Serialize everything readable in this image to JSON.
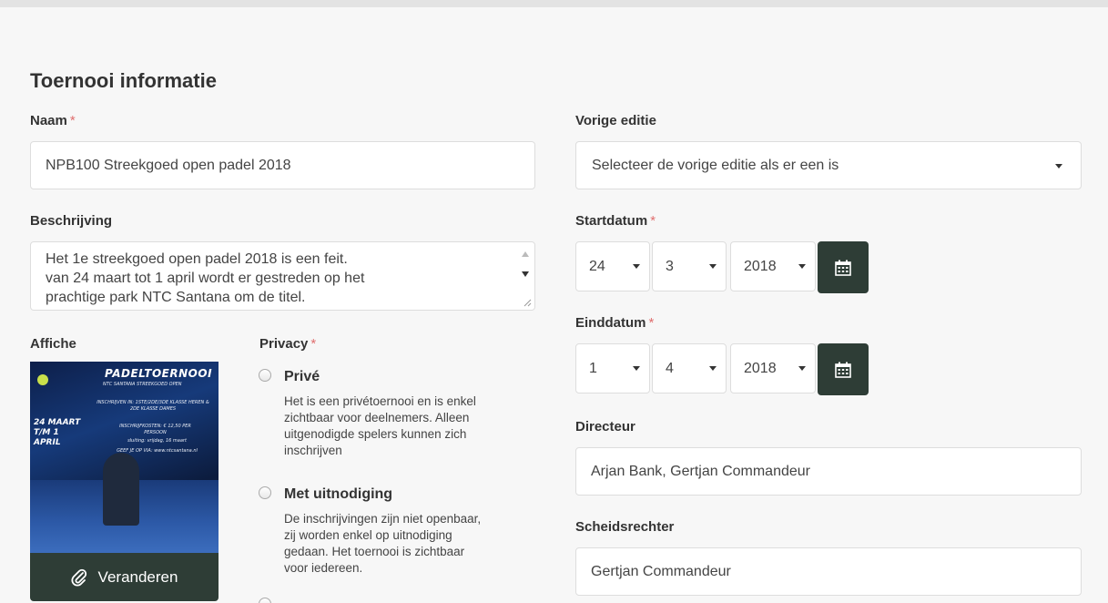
{
  "section_title": "Toernooi informatie",
  "required_mark": "*",
  "naam": {
    "label": "Naam",
    "value": "NPB100 Streekgoed open padel 2018"
  },
  "vorige_editie": {
    "label": "Vorige editie",
    "selected": "Selecteer de vorige editie als er een is"
  },
  "beschrijving": {
    "label": "Beschrijving",
    "line1": "Het 1e streekgoed open padel 2018 is een feit.",
    "line2": "van 24 maart tot 1 april wordt er gestreden op het",
    "line3": "prachtige park NTC Santana om de titel."
  },
  "startdatum": {
    "label": "Startdatum",
    "day": "24",
    "month": "3",
    "year": "2018"
  },
  "einddatum": {
    "label": "Einddatum",
    "day": "1",
    "month": "4",
    "year": "2018"
  },
  "affiche": {
    "label": "Affiche",
    "change_button": "Veranderen",
    "poster_title": "PADELTOERNOOI",
    "poster_subtitle": "NTC SANTANA STREEKGOED OPEN",
    "poster_dates": "24 MAART T/M 1 APRIL",
    "poster_info1": "INSCHRIJVEN IN: 1STE/2DE/3DE KLASSE HEREN & 2DE KLASSE DAMES",
    "poster_info2": "INSCHRIJFKOSTEN: € 12,50 PER PERSOON",
    "poster_info3": "sluiting: vrijdag, 16 maart",
    "poster_info4": "GEEF JE OP VIA: www.ntcsantana.nl"
  },
  "privacy": {
    "label": "Privacy",
    "options": [
      {
        "title": "Privé",
        "desc": [
          "Het is een privétoernooi en is enkel",
          "zichtbaar voor deelnemers. Alleen",
          "uitgenodigde spelers kunnen zich",
          "inschrijven"
        ]
      },
      {
        "title": "Met uitnodiging",
        "desc": [
          "De inschrijvingen zijn niet openbaar,",
          "zij worden enkel op uitnodiging",
          "gedaan. Het toernooi is zichtbaar",
          "voor iedereen."
        ]
      }
    ]
  },
  "directeur": {
    "label": "Directeur",
    "value": "Arjan Bank, Gertjan Commandeur"
  },
  "scheidsrechter": {
    "label": "Scheidsrechter",
    "value": "Gertjan Commandeur"
  },
  "colors": {
    "button_bg": "#2e3d36",
    "required": "#e06e6e",
    "page_bg": "#f7f7f7"
  },
  "icons": {
    "calendar": "calendar-icon",
    "paperclip": "paperclip-icon"
  }
}
